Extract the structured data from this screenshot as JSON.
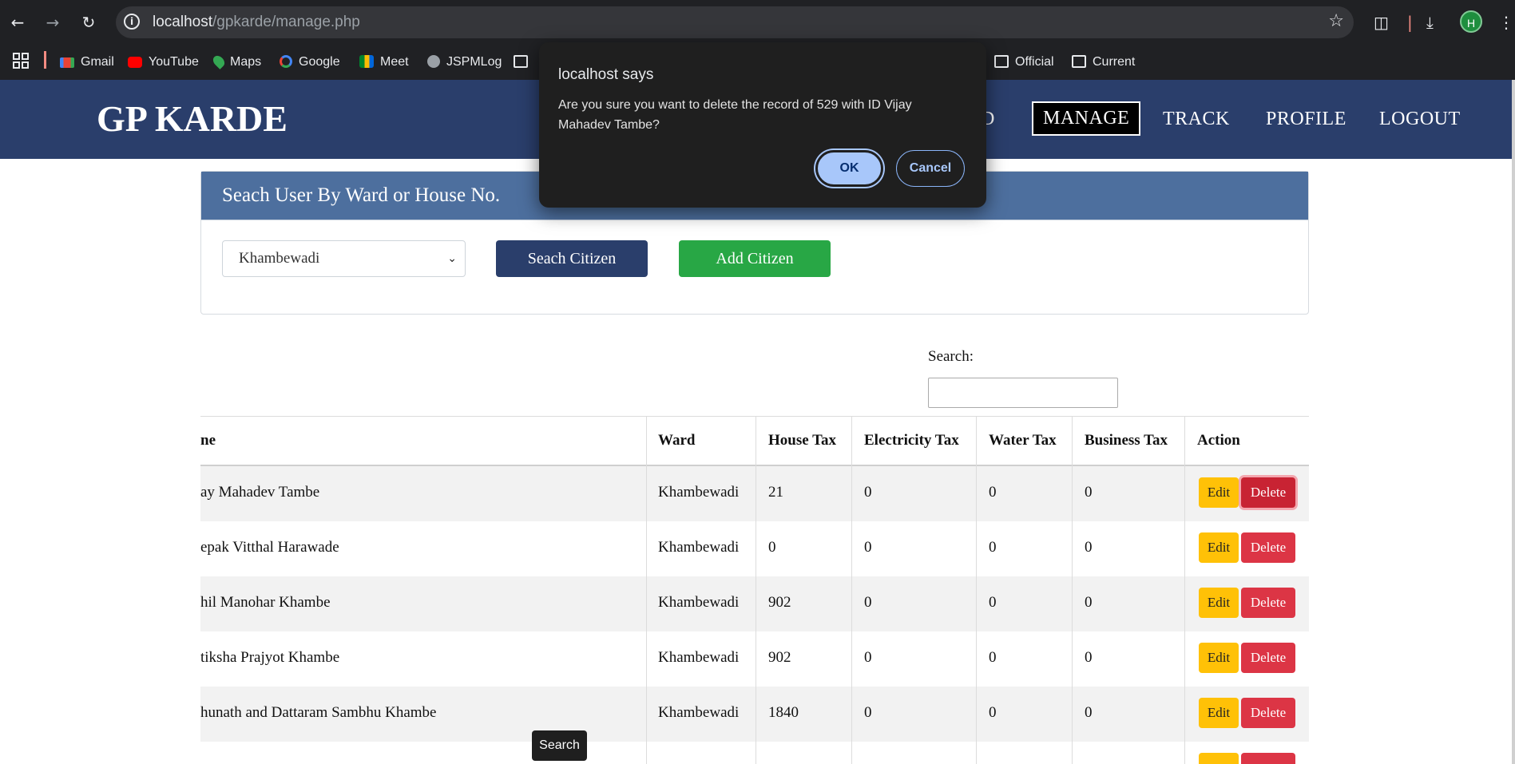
{
  "browser": {
    "url_host": "localhost",
    "url_path": "/gpkarde/manage.php",
    "avatar_letter": "H",
    "bookmarks": [
      "Gmail",
      "YouTube",
      "Maps",
      "Google",
      "Meet",
      "JSPMLog",
      "Official",
      "Current"
    ]
  },
  "header": {
    "brand": "GP KARDE",
    "nav": [
      "D",
      "MANAGE",
      "TRACK",
      "PROFILE",
      "LOGOUT"
    ]
  },
  "search_card": {
    "title": "Seach User By Ward or House No.",
    "ward_selected": "Khambewadi",
    "search_button": "Seach Citizen",
    "add_button": "Add Citizen"
  },
  "table_search": {
    "label": "Search:"
  },
  "table": {
    "headers": [
      "ne",
      "Ward",
      "House Tax",
      "Electricity Tax",
      "Water Tax",
      "Business Tax",
      "Action"
    ],
    "rows": [
      {
        "name": "ay Mahadev Tambe",
        "ward": "Khambewadi",
        "house_tax": "21",
        "electricity_tax": "0",
        "water_tax": "0",
        "business_tax": "0"
      },
      {
        "name": "epak Vitthal Harawade",
        "ward": "Khambewadi",
        "house_tax": "0",
        "electricity_tax": "0",
        "water_tax": "0",
        "business_tax": "0"
      },
      {
        "name": "hil Manohar Khambe",
        "ward": "Khambewadi",
        "house_tax": "902",
        "electricity_tax": "0",
        "water_tax": "0",
        "business_tax": "0"
      },
      {
        "name": "tiksha Prajyot Khambe",
        "ward": "Khambewadi",
        "house_tax": "902",
        "electricity_tax": "0",
        "water_tax": "0",
        "business_tax": "0"
      },
      {
        "name": "hunath and Dattaram Sambhu Khambe",
        "ward": "Khambewadi",
        "house_tax": "1840",
        "electricity_tax": "0",
        "water_tax": "0",
        "business_tax": "0"
      }
    ],
    "edit_label": "Edit",
    "delete_label": "Delete"
  },
  "tooltip": "Search",
  "dialog": {
    "title": "localhost says",
    "message": "Are you sure you want to delete the record of 529 with ID Vijay Mahadev Tambe?",
    "ok": "OK",
    "cancel": "Cancel"
  }
}
